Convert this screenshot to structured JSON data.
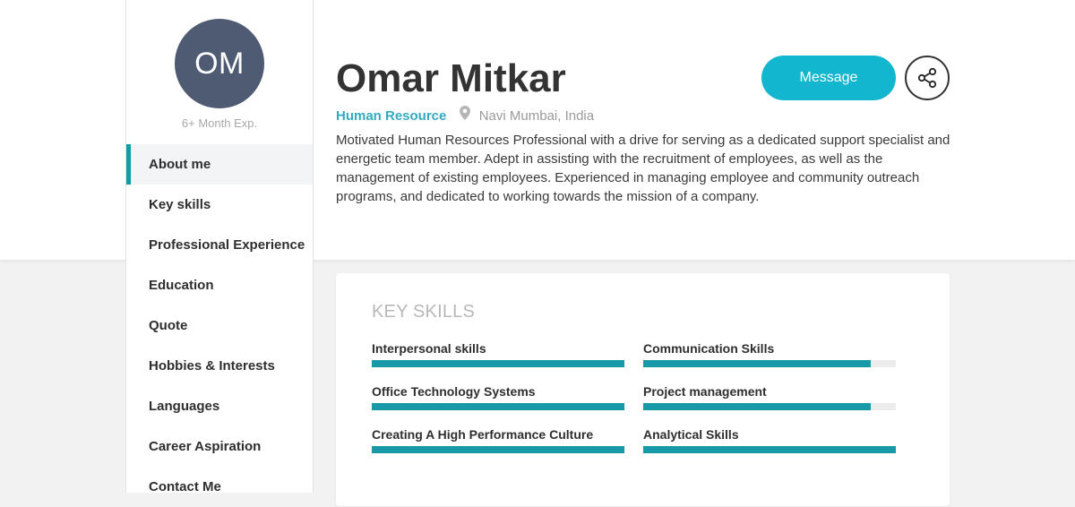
{
  "profile": {
    "initials": "OM",
    "experience": "6+ Month Exp.",
    "name": "Omar Mitkar",
    "role": "Human Resource",
    "location": "Navi Mumbai, India",
    "bio": "Motivated Human Resources Professional with a drive for serving as a dedicated support specialist and energetic team member. Adept in assisting with the recruitment of employees, as well as the management of existing employees. Experienced in managing employee and community outreach programs, and dedicated to working towards the mission of a company.",
    "avatar_color": "#4f5a73"
  },
  "actions": {
    "message_label": "Message",
    "share_icon": "share-icon",
    "accent_color": "#12b6cf"
  },
  "nav": {
    "items": [
      {
        "label": "About me",
        "active": true
      },
      {
        "label": "Key skills",
        "active": false
      },
      {
        "label": "Professional Experience",
        "active": false
      },
      {
        "label": "Education",
        "active": false
      },
      {
        "label": "Quote",
        "active": false
      },
      {
        "label": "Hobbies & Interests",
        "active": false
      },
      {
        "label": "Languages",
        "active": false
      },
      {
        "label": "Career Aspiration",
        "active": false
      },
      {
        "label": "Contact Me",
        "active": false
      }
    ]
  },
  "skills": {
    "title": "KEY SKILLS",
    "bar_color": "#169aa7",
    "items": [
      {
        "label": "Interpersonal skills",
        "level": 1.0
      },
      {
        "label": "Communication Skills",
        "level": 0.9
      },
      {
        "label": "Office Technology Systems",
        "level": 1.0
      },
      {
        "label": "Project management",
        "level": 0.9
      },
      {
        "label": "Creating A High Performance Culture",
        "level": 1.0
      },
      {
        "label": "Analytical Skills",
        "level": 1.0
      }
    ]
  }
}
